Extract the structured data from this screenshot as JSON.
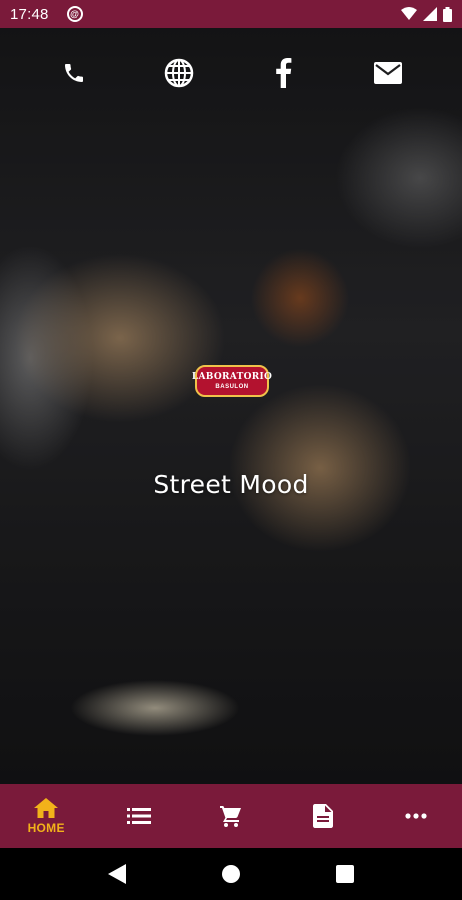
{
  "status_bar": {
    "time": "17:48",
    "notification_glyph": "@"
  },
  "contacts": [
    {
      "icon": "phone-icon"
    },
    {
      "icon": "globe-icon"
    },
    {
      "icon": "facebook-icon"
    },
    {
      "icon": "mail-icon"
    }
  ],
  "logo": {
    "line1": "LABORATORIO",
    "line2": "BASULON"
  },
  "hero": {
    "title": "Street Mood"
  },
  "bottom_nav": {
    "home_label": "HOME",
    "active_color": "#f2b21a",
    "bar_color": "#7a1a3a"
  }
}
